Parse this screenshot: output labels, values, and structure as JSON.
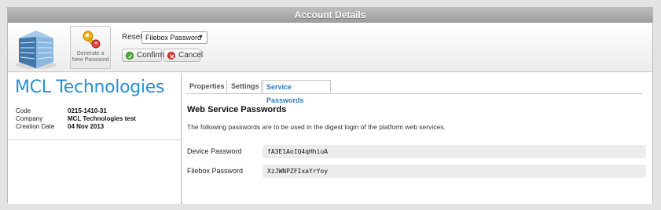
{
  "window": {
    "title": "Account Details"
  },
  "toolbar": {
    "generate_button": {
      "label_line1": "Generate a",
      "label_line2": "New Password",
      "icon": "key-icon"
    },
    "reset": {
      "label": "Reset",
      "selected": "Filebox Password"
    },
    "confirm_label": "Confirm",
    "cancel_label": "Cancel"
  },
  "company": {
    "name": "MCL Technologies",
    "fields": [
      {
        "label": "Code",
        "value": "0215-1410-31"
      },
      {
        "label": "Company",
        "value": "MCL Technologies test"
      },
      {
        "label": "Creation Date",
        "value": "04 Nov 2013"
      }
    ]
  },
  "tabs": [
    {
      "label": "Properties",
      "active": false
    },
    {
      "label": "Settings",
      "active": false
    },
    {
      "label": "Service Passwords",
      "active": true
    }
  ],
  "content": {
    "title": "Web Service Passwords",
    "description": "The following passwords are to be used in the digest login of the platform web services.",
    "passwords": [
      {
        "label": "Device Password",
        "value": "fA3E1AoIQ4qHhiuA"
      },
      {
        "label": "Filebox Password",
        "value": "XzJWNPZFIxaYrYoy"
      }
    ]
  },
  "colors": {
    "accent": "#2a8fd3",
    "confirm": "#4caf32",
    "cancel": "#d94032"
  }
}
